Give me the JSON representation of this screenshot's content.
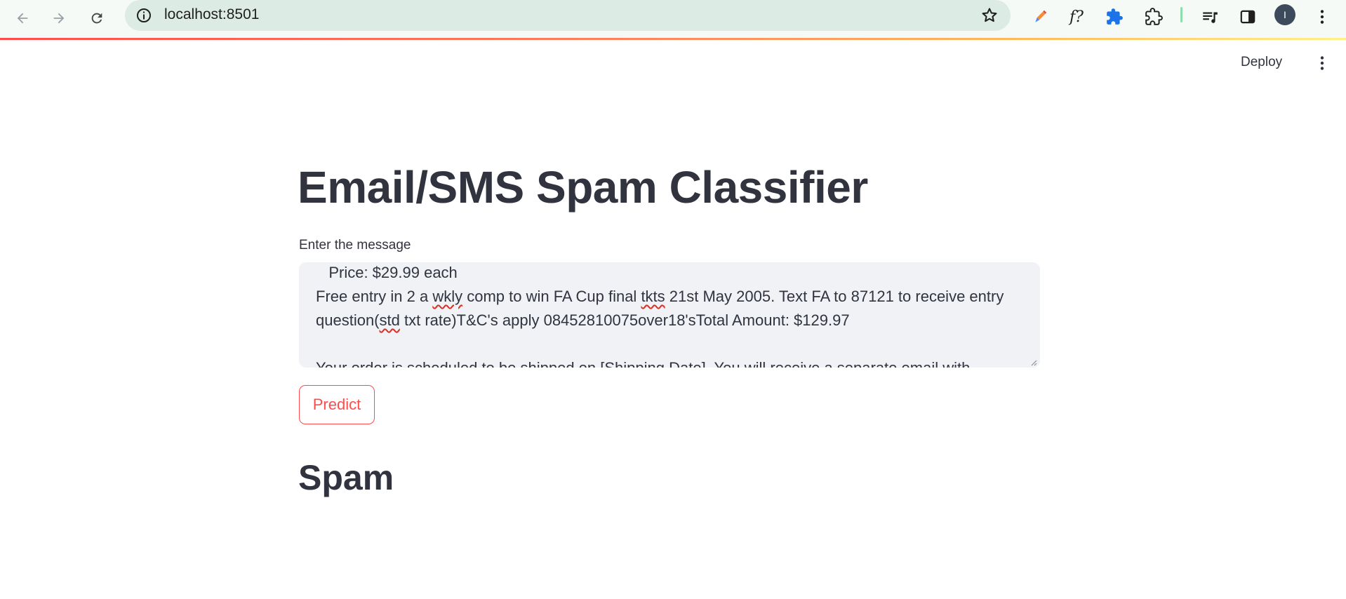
{
  "browser": {
    "url": "localhost:8501",
    "profile_initial": "I",
    "extensions": [
      {
        "name": "color-picker-icon"
      },
      {
        "name": "fx-icon",
        "label": "f?"
      },
      {
        "name": "puzzle-icon"
      },
      {
        "name": "extensions-icon"
      }
    ]
  },
  "app_header": {
    "deploy_label": "Deploy"
  },
  "main": {
    "title": "Email/SMS Spam Classifier",
    "input_label": "Enter the message",
    "message_lines": [
      "   Price: $29.99 each",
      "Free entry in 2 a wkly comp to win FA Cup final tkts 21st May 2005. Text FA to 87121 to receive entry",
      "question(std txt rate)T&C's apply 08452810075over18'sTotal Amount: $129.97",
      "",
      "Your order is scheduled to be shipped on [Shipping Date]. You will receive a separate email with"
    ],
    "predict_label": "Predict",
    "result": "Spam"
  },
  "colors": {
    "primary": "#ff4b4b",
    "text": "#31333f",
    "input_bg": "#f0f2f6",
    "omnibox_bg": "#dcebe3"
  }
}
